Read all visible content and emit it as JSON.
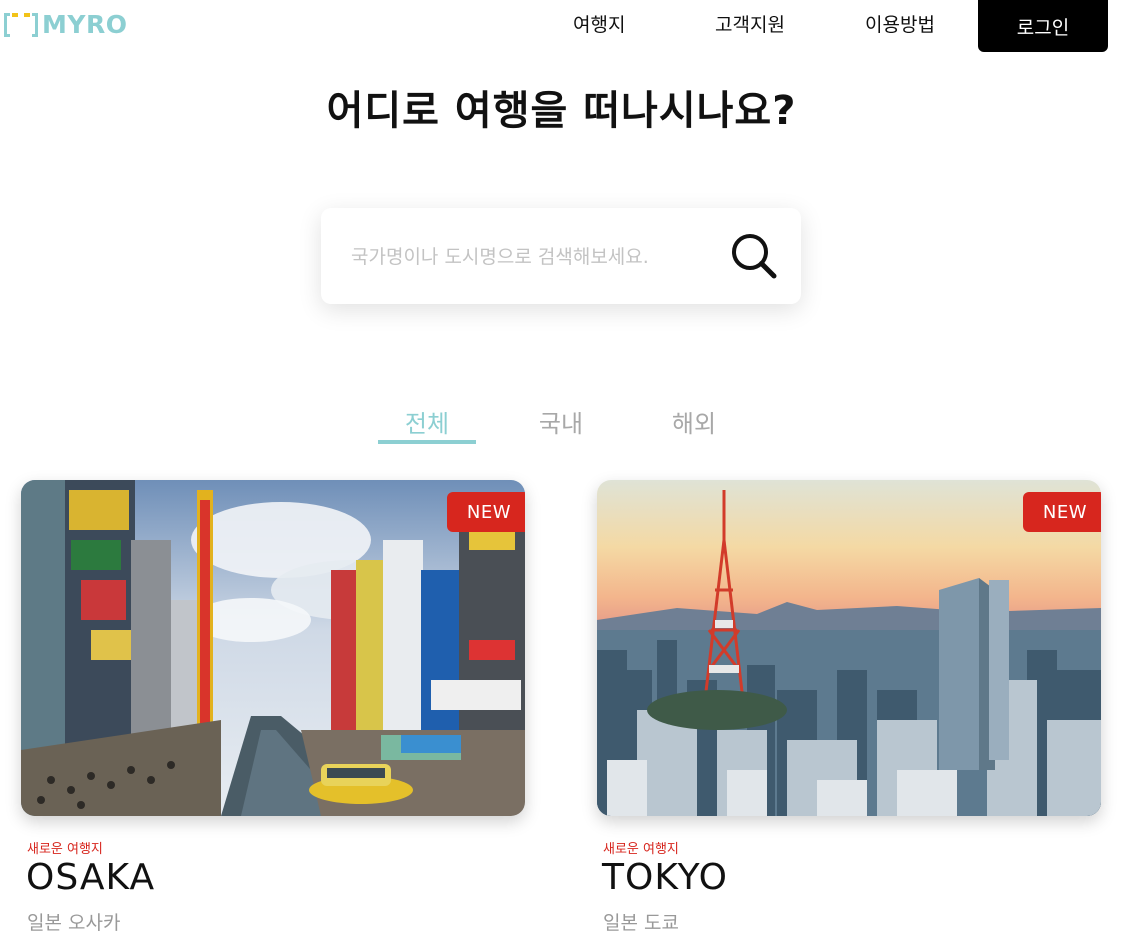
{
  "header": {
    "logo_text": "MYRO",
    "nav": [
      "여행지",
      "고객지원",
      "이용방법"
    ],
    "login_label": "로그인"
  },
  "title": "어디로 여행을 떠나시나요?",
  "search": {
    "placeholder": "국가명이나 도시명으로 검색해보세요.",
    "value": ""
  },
  "tabs": [
    {
      "label": "전체",
      "active": true
    },
    {
      "label": "국내",
      "active": false
    },
    {
      "label": "해외",
      "active": false
    }
  ],
  "cards": [
    {
      "badge": "NEW",
      "subtitle": "새로운 여행지",
      "name": "OSAKA",
      "location": "일본 오사카"
    },
    {
      "badge": "NEW",
      "subtitle": "새로운 여행지",
      "name": "TOKYO",
      "location": "일본 도쿄"
    }
  ],
  "colors": {
    "brand": "#8ccfd2",
    "accent_yellow": "#f2c318",
    "badge": "#d7261e",
    "login_bg": "#000000",
    "tab_inactive": "#a8a8a8"
  },
  "icons": [
    "search-icon",
    "logo-icon"
  ]
}
